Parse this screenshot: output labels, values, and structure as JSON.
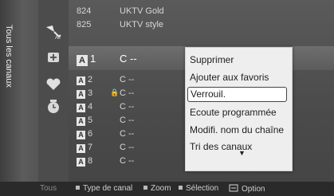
{
  "sidebar": {
    "label": "Tous les canaux"
  },
  "icons": [
    "satellite-icon",
    "add-channel-icon",
    "favorite-heart-icon",
    "clock-icon"
  ],
  "channels_top": [
    {
      "num": "824",
      "name": "UKTV Gold"
    },
    {
      "num": "825",
      "name": "UKTV style"
    }
  ],
  "selected": {
    "badge": "A",
    "num": "1",
    "name": "C --"
  },
  "channels": [
    {
      "badge": "A",
      "num": "2",
      "name": "C --"
    },
    {
      "badge": "A",
      "num": "3",
      "name": "C --",
      "locked": true
    },
    {
      "badge": "A",
      "num": "4",
      "name": "C --"
    },
    {
      "badge": "A",
      "num": "5",
      "name": "C --"
    },
    {
      "badge": "A",
      "num": "6",
      "name": "C --"
    },
    {
      "badge": "A",
      "num": "7",
      "name": "C --"
    },
    {
      "badge": "A",
      "num": "8",
      "name": "C --"
    }
  ],
  "menu": {
    "items": [
      "Supprimer",
      "Ajouter aux favoris",
      "Verrouil.",
      "Ecoute programmée",
      "Modifi. nom du chaîne",
      "Tri des canaux"
    ],
    "active_index": 2,
    "more_indicator": "▼"
  },
  "status_bar": {
    "tous": "Tous",
    "items": [
      {
        "icon": "square-icon",
        "label": "Type de canal"
      },
      {
        "icon": "square-icon",
        "label": "Zoom"
      },
      {
        "icon": "square-icon",
        "label": "Sélection"
      },
      {
        "icon": "tools-icon",
        "label": "Option"
      }
    ]
  },
  "colors": {
    "menu_bg": "#eeeeee",
    "active_border": "#444444",
    "screen_bg": "#4a4a4a"
  }
}
